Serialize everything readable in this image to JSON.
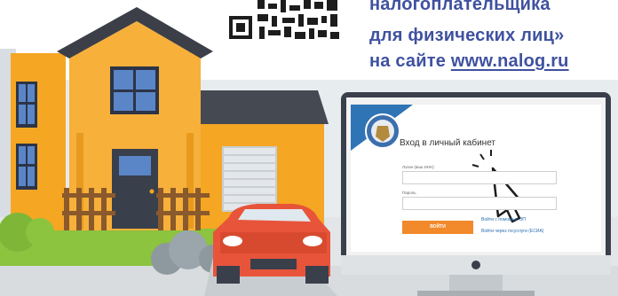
{
  "promo": {
    "line1": "налогоплательщика",
    "line2": "для физических лиц»",
    "line3_prefix": "на сайте ",
    "line3_url": "www.nalog.ru"
  },
  "screen": {
    "title": "Вход в личный кабинет",
    "login_label": "Логин (ваш ИНН)",
    "password_label": "Пароль",
    "submit_button": "ВОЙТИ",
    "link_ep": "Войти с помощью ЭП",
    "link_esia": "Войти через госуслуги (ЕСИА)"
  },
  "colors": {
    "promo_text": "#3f51a0",
    "house_wall": "#f5a623",
    "roof": "#3c3f48",
    "car": "#e8543a",
    "sky": "#e9eef1",
    "button": "#f2892a"
  },
  "icons": {
    "qr": "qr-code-icon",
    "cursor": "hand-pointer-icon",
    "emblem": "tax-service-emblem-icon"
  }
}
